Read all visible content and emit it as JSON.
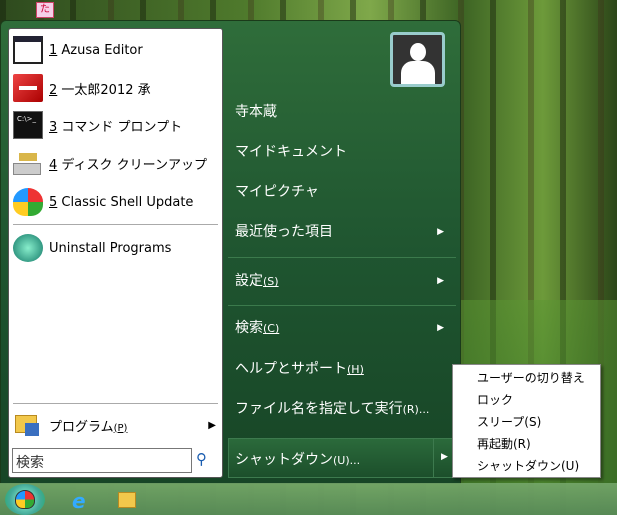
{
  "desktop": {
    "icon_text": "た"
  },
  "left_panel": {
    "recent": [
      {
        "num": "1",
        "label": " Azusa Editor",
        "icon": "window-icon"
      },
      {
        "num": "2",
        "label": " 一太郎2012 承",
        "icon": "ichitaro-icon"
      },
      {
        "num": "3",
        "label": " コマンド プロンプト",
        "icon": "cmd-icon"
      },
      {
        "num": "4",
        "label": " ディスク クリーンアップ",
        "icon": "disk-cleanup-icon"
      },
      {
        "num": "5",
        "label": " Classic Shell Update",
        "icon": "classic-shell-icon"
      }
    ],
    "uninstall": "Uninstall Programs",
    "programs": "プログラム",
    "programs_key": "(P)",
    "search_value": "検索"
  },
  "right_panel": {
    "user": "寺本蔵",
    "documents": "マイドキュメント",
    "pictures": "マイピクチャ",
    "recent_items": "最近使った項目",
    "settings": "設定",
    "settings_key": "(S)",
    "search": "検索",
    "search_key": "(C)",
    "help": "ヘルプとサポート",
    "help_key": "(H)",
    "run": "ファイル名を指定して実行",
    "run_key": "(R)...",
    "shutdown": "シャットダウン",
    "shutdown_key": "(U)..."
  },
  "shutdown_submenu": [
    "ユーザーの切り替え",
    "ロック",
    "スリープ(S)",
    "再起動(R)",
    "シャットダウン(U)"
  ]
}
